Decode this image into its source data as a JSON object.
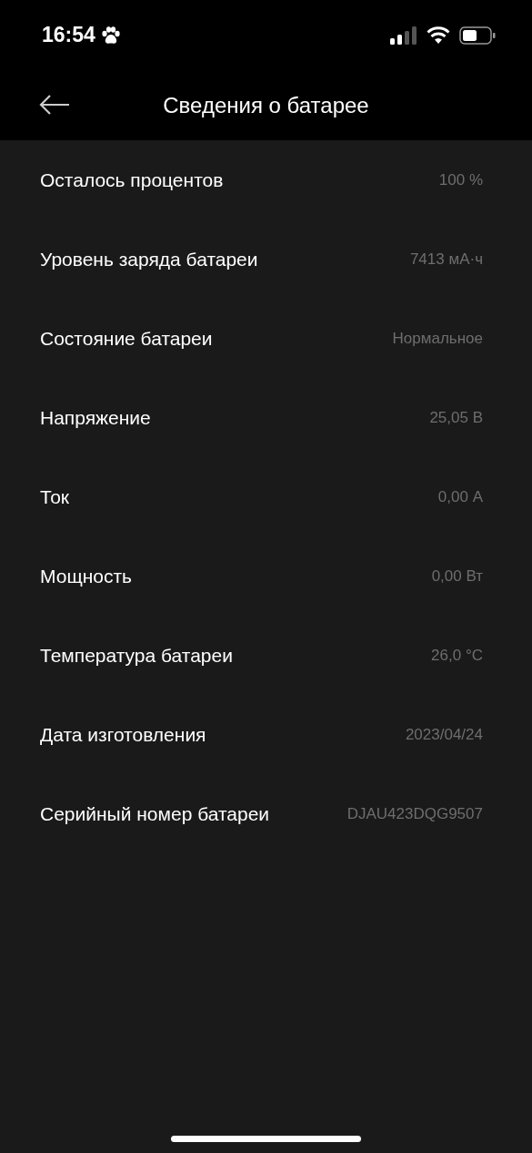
{
  "status_bar": {
    "time": "16:54"
  },
  "header": {
    "title": "Сведения о батарее"
  },
  "rows": [
    {
      "label": "Осталось процентов",
      "value": "100 %"
    },
    {
      "label": "Уровень заряда батареи",
      "value": "7413 мА·ч"
    },
    {
      "label": "Состояние батареи",
      "value": "Нормальное"
    },
    {
      "label": "Напряжение",
      "value": "25,05 В"
    },
    {
      "label": "Ток",
      "value": "0,00 А"
    },
    {
      "label": "Мощность",
      "value": "0,00 Вт"
    },
    {
      "label": "Температура батареи",
      "value": "26,0 °C"
    },
    {
      "label": "Дата изготовления",
      "value": "2023/04/24"
    },
    {
      "label": "Серийный номер батареи",
      "value": "DJAU423DQG9507"
    }
  ]
}
